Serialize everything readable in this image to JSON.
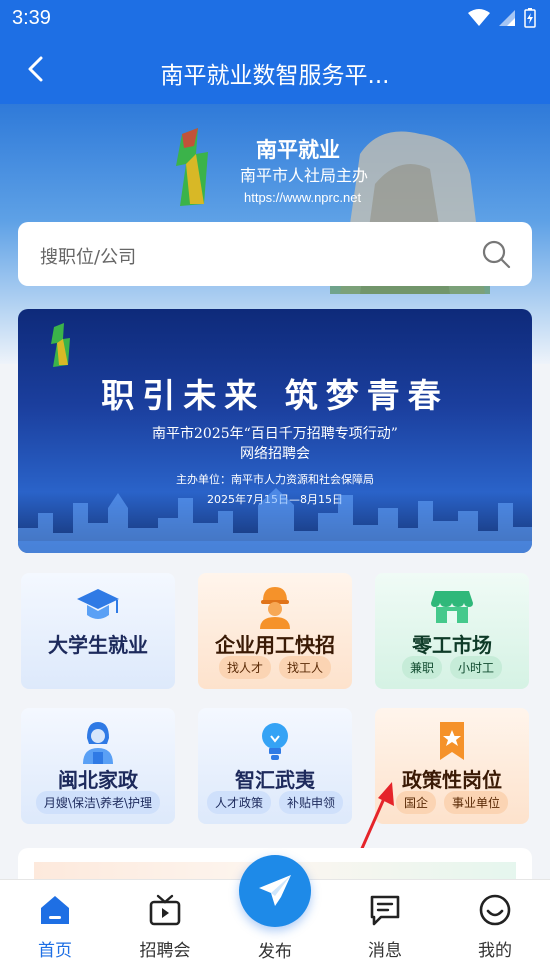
{
  "status_bar": {
    "time": "3:39"
  },
  "header": {
    "title": "南平就业数智服务平..."
  },
  "hero": {
    "brand": "南平就业",
    "subtitle": "南平市人社局主办",
    "url": "https://www.nprc.net"
  },
  "search": {
    "placeholder": "搜职位/公司"
  },
  "banner": {
    "headline": "职引未来 筑梦青春",
    "line1": "南平市2025年“百日千万招聘专项行动”",
    "line2": "网络招聘会",
    "organizer": "主办单位：南平市人力资源和社会保障局",
    "date": "2025年7月15日—8月15日"
  },
  "cards": [
    {
      "name": "大学生就业",
      "icon": "graduation-cap-icon",
      "tags": []
    },
    {
      "name": "企业用工快招",
      "icon": "worker-icon",
      "tags": [
        "找人才",
        "找工人"
      ]
    },
    {
      "name": "零工市场",
      "icon": "shop-icon",
      "tags": [
        "兼职",
        "小时工"
      ]
    },
    {
      "name": "闽北家政",
      "icon": "housekeeper-icon",
      "tags": [
        "月嫂\\保洁\\养老\\护理"
      ]
    },
    {
      "name": "智汇武夷",
      "icon": "lightbulb-icon",
      "tags": [
        "人才政策",
        "补贴申领"
      ]
    },
    {
      "name": "政策性岗位",
      "icon": "bookmark-star-icon",
      "tags": [
        "国企",
        "事业单位"
      ]
    }
  ],
  "nav": {
    "items": [
      {
        "label": "首页",
        "icon": "home-icon"
      },
      {
        "label": "招聘会",
        "icon": "tv-icon"
      },
      {
        "label": "发布",
        "icon": "paper-plane-icon"
      },
      {
        "label": "消息",
        "icon": "message-icon"
      },
      {
        "label": "我的",
        "icon": "smile-icon"
      }
    ]
  },
  "colors": {
    "primary": "#1e6fe4",
    "fab": "#1e8ae8",
    "arrow": "#e5242a"
  }
}
